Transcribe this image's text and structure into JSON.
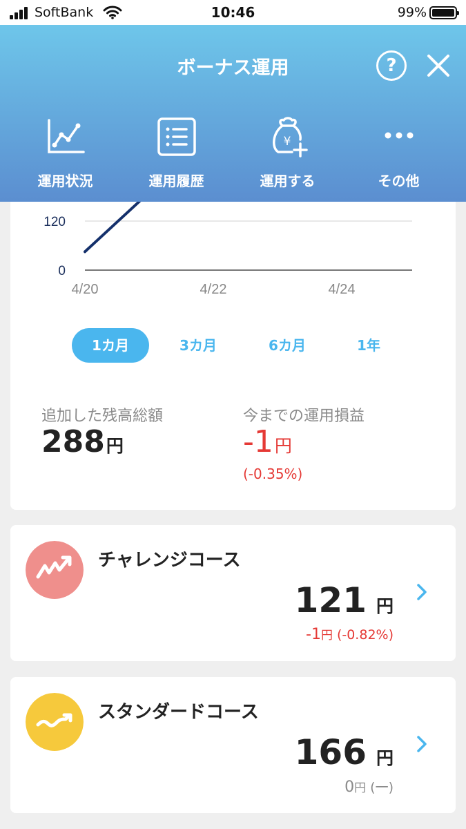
{
  "status_bar": {
    "carrier": "SoftBank",
    "time": "10:46",
    "battery": "99%"
  },
  "header": {
    "title": "ボーナス運用",
    "help_label": "?",
    "nav": [
      {
        "label": "運用状況",
        "icon": "line-chart-icon"
      },
      {
        "label": "運用履歴",
        "icon": "list-icon"
      },
      {
        "label": "運用する",
        "icon": "money-bag-plus-icon"
      },
      {
        "label": "その他",
        "icon": "more-dots-icon"
      }
    ]
  },
  "chart_data": {
    "type": "line",
    "x_ticks": [
      "4/20",
      "4/22",
      "4/24"
    ],
    "y_ticks": [
      "120",
      "0"
    ],
    "series": [
      {
        "x": [
          "4/20",
          "4/21"
        ],
        "values": [
          45,
          190
        ]
      }
    ],
    "colors": {
      "line": "#14306b",
      "grid": "#e0e0e0",
      "axis": "#777777"
    }
  },
  "period_tabs": [
    {
      "label": "1カ月",
      "active": true
    },
    {
      "label": "3カ月",
      "active": false
    },
    {
      "label": "6カ月",
      "active": false
    },
    {
      "label": "1年",
      "active": false
    }
  ],
  "summary": {
    "added_label": "追加した残高総額",
    "added_value": "288",
    "added_unit": "円",
    "profit_label": "今までの運用損益",
    "profit_value": "-1",
    "profit_unit": "円",
    "profit_pct": "(-0.35%)"
  },
  "courses": [
    {
      "name": "チャレンジコース",
      "amount": "121",
      "unit": "円",
      "change": "-1",
      "change_unit": "円",
      "change_pct": "(-0.82%)",
      "icon_color": "#ef8f8c",
      "change_color": "#e53935",
      "icon": "zigzag-up-icon"
    },
    {
      "name": "スタンダードコース",
      "amount": "166",
      "unit": "円",
      "change": "0",
      "change_unit": "円",
      "change_pct": "(一)",
      "icon_color": "#f6c93c",
      "change_color": "#8a8a8a",
      "icon": "wave-up-icon"
    }
  ],
  "colors": {
    "accent": "#4ab6ee",
    "loss": "#e53935",
    "header_top": "#6ec6ea",
    "header_bottom": "#5b8ed0"
  }
}
